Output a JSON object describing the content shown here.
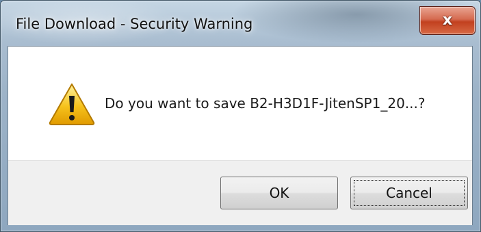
{
  "dialog": {
    "title": "File Download - Security Warning",
    "close_icon": "close-icon",
    "close_glyph": "x",
    "message": "Do you want to save B2-H3D1F-JitenSP1_20...?",
    "warning_icon": "warning-icon",
    "buttons": {
      "ok_label": "OK",
      "cancel_label": "Cancel"
    },
    "colors": {
      "close_button": "#c94a2a",
      "warning_fill": "#f6c21c",
      "client_background": "#ffffff",
      "footer_background": "#f0f0f0"
    }
  }
}
